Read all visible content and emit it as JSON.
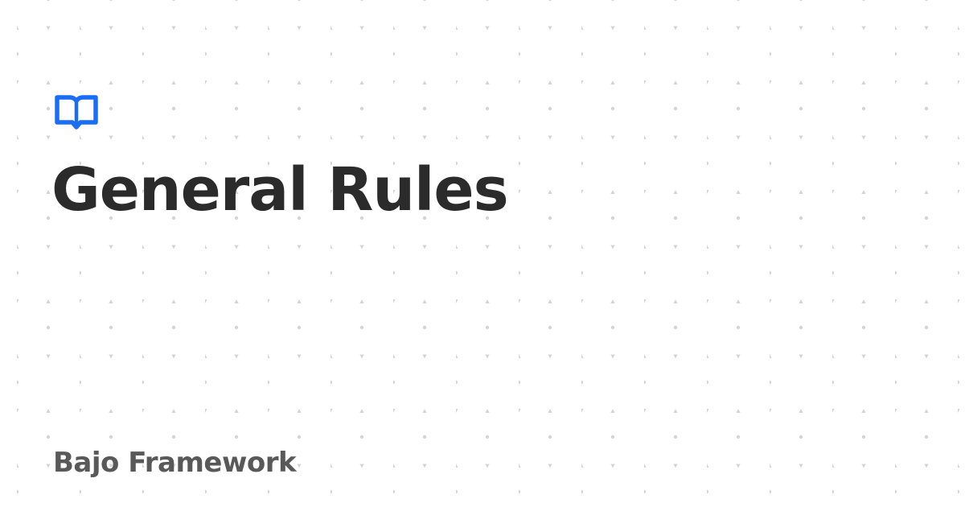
{
  "page": {
    "title": "General Rules",
    "site_name": "Bajo Framework"
  },
  "icons": {
    "logo": "open-book-icon"
  },
  "colors": {
    "background": "#ffffff",
    "dot_pattern": "#d4d4d4",
    "logo_accent": "#1a6ef5",
    "title_text": "#2b2b2b",
    "site_name_text": "#595959"
  }
}
